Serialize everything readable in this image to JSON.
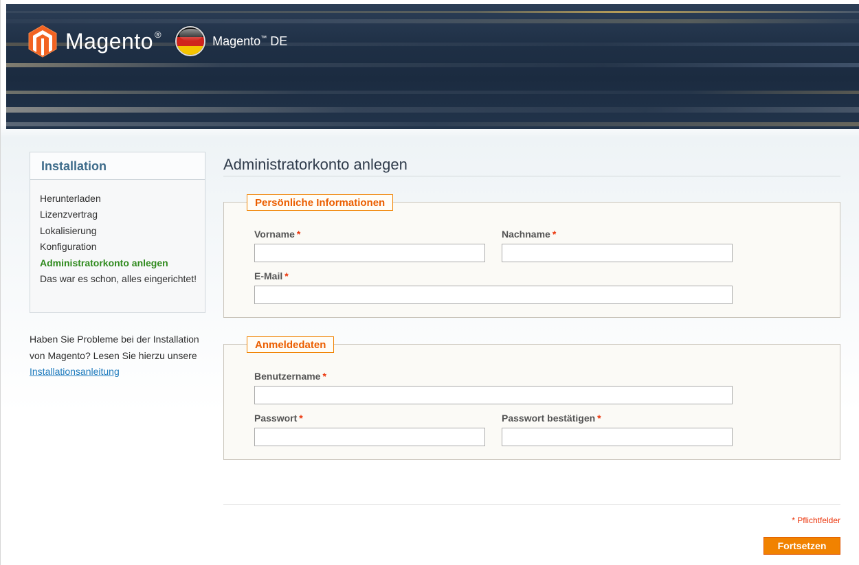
{
  "header": {
    "brand_name": "Magento",
    "brand_mark": "®",
    "locale_name": "Magento",
    "locale_mark": "™",
    "locale_suffix": " DE",
    "logo_icon": "magento-logo-icon",
    "flag_icon": "german-flag-icon"
  },
  "sidebar": {
    "title": "Installation",
    "steps": [
      {
        "label": "Herunterladen",
        "active": false
      },
      {
        "label": "Lizenzvertrag",
        "active": false
      },
      {
        "label": "Lokalisierung",
        "active": false
      },
      {
        "label": "Konfiguration",
        "active": false
      },
      {
        "label": "Administratorkonto anlegen",
        "active": true
      },
      {
        "label": "Das war es schon, alles eingerichtet!",
        "active": false
      }
    ],
    "help_text": "Haben Sie Probleme bei der Installation von Magento? Lesen Sie hierzu unsere",
    "help_link": "Installationsanleitung"
  },
  "main": {
    "title": "Administratorkonto anlegen",
    "personal": {
      "legend": "Persönliche Informationen",
      "firstname_label": "Vorname",
      "lastname_label": "Nachname",
      "email_label": "E-Mail",
      "firstname_value": "",
      "lastname_value": "",
      "email_value": ""
    },
    "login": {
      "legend": "Anmeldedaten",
      "username_label": "Benutzername",
      "password_label": "Passwort",
      "confirm_label": "Passwort bestätigen",
      "username_value": "",
      "password_value": "",
      "confirm_value": ""
    },
    "required_marker": "*",
    "required_note": "* Pflichtfelder",
    "continue_button": "Fortsetzen"
  },
  "colors": {
    "accent_orange": "#f18200",
    "active_step_green": "#2f8a1d",
    "required_red": "#eb340a",
    "link_blue": "#1e7bbd"
  }
}
